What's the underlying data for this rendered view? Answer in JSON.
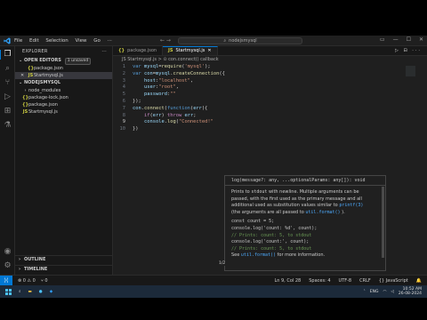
{
  "titlebar": {
    "menu": [
      "File",
      "Edit",
      "Selection",
      "View",
      "Go"
    ],
    "menu_more": "···",
    "nav": "← →",
    "search": "nodejsmysql"
  },
  "activitybar": {
    "icons": [
      "files-icon",
      "search-icon",
      "source-control-icon",
      "run-debug-icon",
      "extensions-icon",
      "test-icon",
      "account-icon",
      "settings-icon"
    ]
  },
  "explorer": {
    "title": "EXPLORER",
    "more": "···",
    "open_editors": {
      "label": "OPEN EDITORS",
      "badge": "1 unsaved",
      "items": [
        {
          "name": "package.json",
          "type": "json",
          "selected": false
        },
        {
          "name": "Startmysql.js",
          "type": "js",
          "selected": true
        }
      ]
    },
    "workspace": {
      "label": "NODEJSMYSQL",
      "items": [
        {
          "name": "node_modules",
          "type": "folder"
        },
        {
          "name": "package-lock.json",
          "type": "json"
        },
        {
          "name": "package.json",
          "type": "json"
        },
        {
          "name": "Startmysql.js",
          "type": "js"
        }
      ]
    },
    "outline": "OUTLINE",
    "timeline": "TIMELINE"
  },
  "tabs": [
    {
      "label": "package.json",
      "type": "json",
      "active": false
    },
    {
      "label": "Startmysql.js",
      "type": "js",
      "active": true
    }
  ],
  "tab_actions": "▷ ⊟ ···",
  "breadcrumb": "JS Startmysql.js > ⊙ con.connect() callback",
  "code_lines": [
    {
      "n": "1",
      "tokens": [
        {
          "t": "var ",
          "c": "k"
        },
        {
          "t": "mysql",
          "c": "v"
        },
        {
          "t": "=",
          "c": "p"
        },
        {
          "t": "require",
          "c": "f"
        },
        {
          "t": "(",
          "c": "p"
        },
        {
          "t": "'mysql'",
          "c": "s"
        },
        {
          "t": ");",
          "c": "p"
        }
      ]
    },
    {
      "n": "2",
      "tokens": [
        {
          "t": "var ",
          "c": "k"
        },
        {
          "t": "con",
          "c": "v"
        },
        {
          "t": "=",
          "c": "p"
        },
        {
          "t": "mysql",
          "c": "v"
        },
        {
          "t": ".",
          "c": "p"
        },
        {
          "t": "createConnection",
          "c": "f"
        },
        {
          "t": "({",
          "c": "p"
        }
      ]
    },
    {
      "n": "3",
      "tokens": [
        {
          "t": "    host",
          "c": "v"
        },
        {
          "t": ":",
          "c": "p"
        },
        {
          "t": "\"localhost\"",
          "c": "s"
        },
        {
          "t": ",",
          "c": "p"
        }
      ]
    },
    {
      "n": "4",
      "tokens": [
        {
          "t": "    user",
          "c": "v"
        },
        {
          "t": ":",
          "c": "p"
        },
        {
          "t": "\"root\"",
          "c": "s"
        },
        {
          "t": ",",
          "c": "p"
        }
      ]
    },
    {
      "n": "5",
      "tokens": [
        {
          "t": "    password",
          "c": "v"
        },
        {
          "t": ":",
          "c": "p"
        },
        {
          "t": "\"\"",
          "c": "s"
        }
      ]
    },
    {
      "n": "6",
      "tokens": [
        {
          "t": "});",
          "c": "p"
        }
      ]
    },
    {
      "n": "7",
      "tokens": [
        {
          "t": "con",
          "c": "v"
        },
        {
          "t": ".",
          "c": "p"
        },
        {
          "t": "connect",
          "c": "f"
        },
        {
          "t": "(",
          "c": "p"
        },
        {
          "t": "function",
          "c": "k"
        },
        {
          "t": "(",
          "c": "p"
        },
        {
          "t": "err",
          "c": "v"
        },
        {
          "t": "){",
          "c": "p"
        }
      ]
    },
    {
      "n": "8",
      "tokens": [
        {
          "t": "    ",
          "c": "p"
        },
        {
          "t": "if",
          "c": "c"
        },
        {
          "t": "(",
          "c": "p"
        },
        {
          "t": "err",
          "c": "v"
        },
        {
          "t": ") ",
          "c": "p"
        },
        {
          "t": "throw ",
          "c": "c"
        },
        {
          "t": "err",
          "c": "v"
        },
        {
          "t": ";",
          "c": "p"
        }
      ]
    },
    {
      "n": "9",
      "tokens": [
        {
          "t": "    ",
          "c": "p"
        },
        {
          "t": "console",
          "c": "v"
        },
        {
          "t": ".",
          "c": "p"
        },
        {
          "t": "log",
          "c": "f"
        },
        {
          "t": "(",
          "c": "p"
        },
        {
          "t": "\"Connected!\"",
          "c": "s"
        }
      ]
    },
    {
      "n": "10",
      "tokens": [
        {
          "t": "})",
          "c": "p"
        }
      ]
    }
  ],
  "current_line": "9",
  "hover": {
    "signature": "log(message?: any, ...optionalParams: any[]): void",
    "doc_line1_a": "Prints to ",
    "doc_line1_code": "stdout",
    "doc_line1_b": " with newline. Multiple arguments can be",
    "doc_line2": "passed, with the first used as the primary message and all",
    "doc_line3_a": "additional used as substitution values similar to ",
    "doc_line3_link": "printf(3)",
    "doc_line4_a": "(the arguments are all passed to ",
    "doc_line4_link": "util.format()",
    "doc_line4_b": " ).",
    "example": [
      {
        "t": "const count = 5;",
        "cmt": false
      },
      {
        "t": "console.log('count: %d', count);",
        "cmt": false
      },
      {
        "t": "// Prints: count: 5, to stdout",
        "cmt": true
      },
      {
        "t": "console.log('count:', count);",
        "cmt": false
      },
      {
        "t": "// Prints: count: 5, to stdout",
        "cmt": true
      }
    ],
    "see_a": "See ",
    "see_link": "util.format()",
    "see_b": " for more information.",
    "pager": "1/2"
  },
  "statusbar": {
    "errors": "⊗ 0 ⚠ 0",
    "ports": "⑂ 0",
    "position": "Ln 9, Col 28",
    "spaces": "Spaces: 4",
    "encoding": "UTF-8",
    "eol": "CRLF",
    "language": "{} JavaScript",
    "bell": "🔔"
  },
  "taskbar": {
    "time": "10:52 AM",
    "date": "26-08-2024",
    "lang": "ENG"
  }
}
